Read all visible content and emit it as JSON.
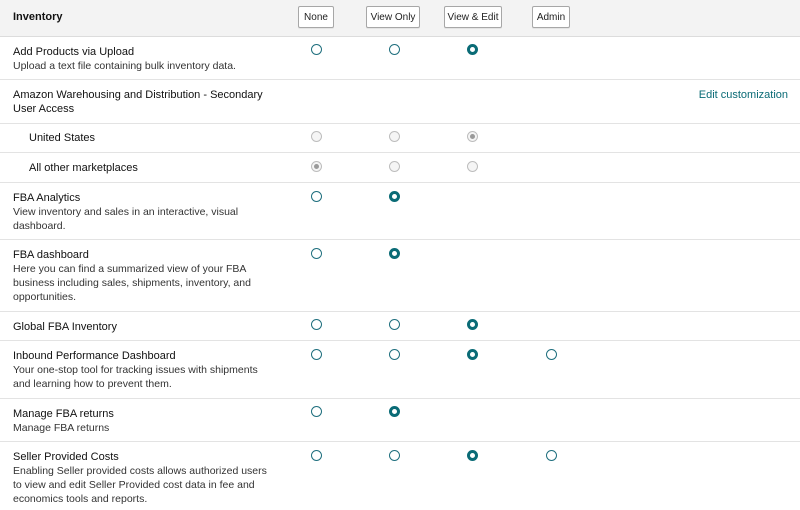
{
  "header": {
    "title": "Inventory",
    "columns": [
      "None",
      "View Only",
      "View & Edit",
      "Admin"
    ]
  },
  "rows": [
    {
      "title": "Add Products via Upload",
      "desc": [
        "Upload a text file containing bulk inventory data."
      ]
    },
    {
      "title_lines": [
        "Amazon Warehousing and Distribution - Secondary",
        "User Access"
      ],
      "link": "Edit customization"
    },
    {
      "title": "United States"
    },
    {
      "title": "All other marketplaces"
    },
    {
      "title": "FBA Analytics",
      "desc": [
        "View inventory and sales in an interactive, visual",
        "dashboard."
      ]
    },
    {
      "title": "FBA dashboard",
      "desc": [
        "Here you can find a summarized view of your FBA",
        "business including sales, shipments, inventory, and",
        "opportunities."
      ]
    },
    {
      "title": "Global FBA Inventory"
    },
    {
      "title": "Inbound Performance Dashboard",
      "desc": [
        "Your one-stop tool for tracking issues with shipments",
        "and learning how to prevent them."
      ]
    },
    {
      "title": "Manage FBA returns",
      "desc": [
        "Manage FBA returns"
      ]
    },
    {
      "title": "Seller Provided Costs",
      "desc": [
        "Enabling Seller provided costs allows authorized users",
        "to view and edit Seller Provided cost data in fee and",
        "economics tools and reports."
      ]
    }
  ]
}
